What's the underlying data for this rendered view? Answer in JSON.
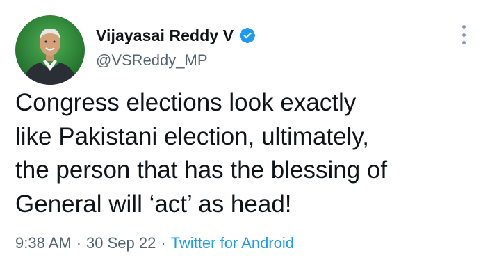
{
  "author": {
    "display_name": "Vijayasai Reddy V",
    "handle": "@VSReddy_MP",
    "verified": true,
    "avatar_icon": "profile-photo"
  },
  "tweet": {
    "text": "Congress elections look exactly\nlike Pakistani election, ultimately,\nthe person that has the blessing of\nGeneral will ‘act’ as head!"
  },
  "meta": {
    "time": "9:38 AM",
    "separator": "·",
    "date": "30 Sep 22",
    "source": "Twitter for Android"
  },
  "icons": {
    "verified": "verified-badge-icon",
    "more": "more-options-icon"
  },
  "colors": {
    "accent": "#1d9bf0",
    "text_primary": "#0f1419",
    "text_secondary": "#536471",
    "avatar_background": "#2f8a3a"
  }
}
